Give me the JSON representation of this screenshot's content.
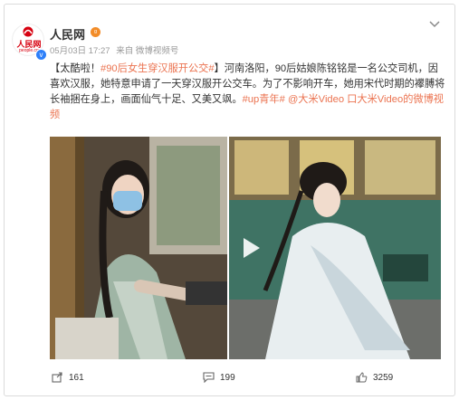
{
  "post": {
    "author": "人民网",
    "author_logo_text": "人民网",
    "author_logo_sub": "people.cn",
    "date": "05月03日 17:27",
    "source": "来自 微博视频号",
    "text_bracket_open": "【",
    "text_lead": "太酷啦！",
    "text_hashtag": "#90后女生穿汉服开公交#",
    "text_bracket_close": "】",
    "text_body": "河南洛阳，90后姑娘陈铭铭是一名公交司机，因喜欢汉服，她特意申请了一天穿汉服开公交车。为了不影响开车，她用宋代时期的襻膊将长袖捆在身上，画面仙气十足、又美又飒。",
    "text_tag2": "#up青年#",
    "text_mention": "@大米Video",
    "text_video_link": "口大米Video的微博视频"
  },
  "actions": {
    "shares": "161",
    "comments": "199",
    "likes": "3259"
  },
  "colors": {
    "link": "#eb7350",
    "verified": "#2d7ff9"
  },
  "icons": [
    "share-icon",
    "comment-icon",
    "like-icon",
    "chevron-down-icon",
    "play-icon",
    "verified-icon"
  ]
}
